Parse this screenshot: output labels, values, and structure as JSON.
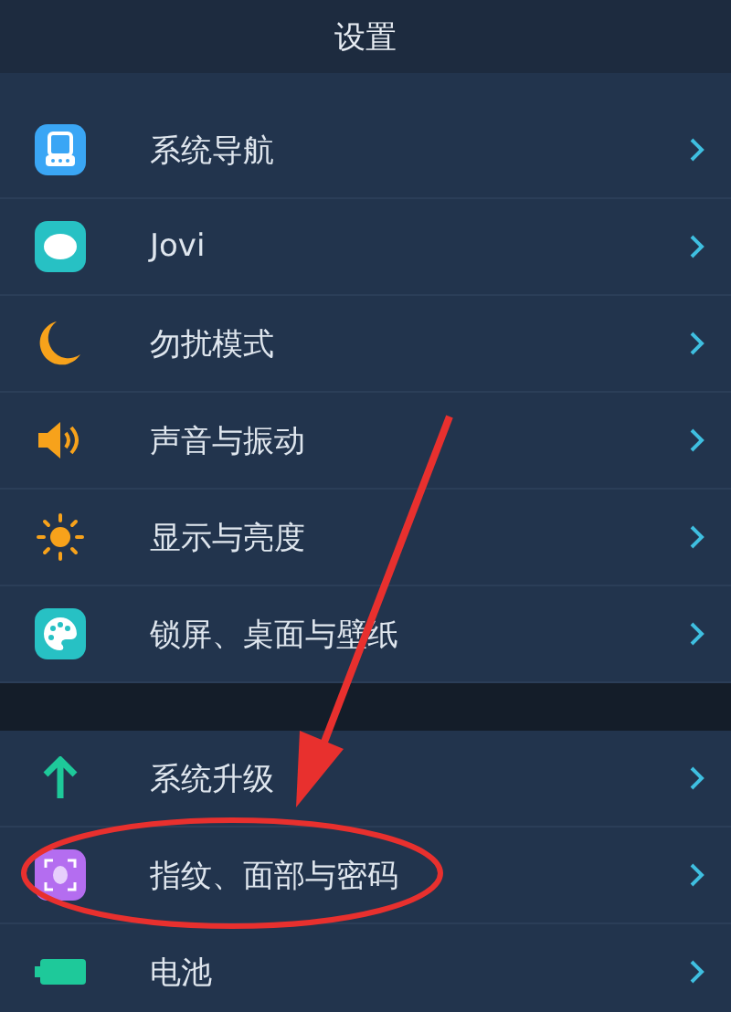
{
  "header": {
    "title": "设置"
  },
  "sections": [
    {
      "items": [
        {
          "label": "系统导航",
          "kind": "nav"
        },
        {
          "label": "Jovi",
          "kind": "jovi"
        },
        {
          "label": "勿扰模式",
          "kind": "moon"
        },
        {
          "label": "声音与振动",
          "kind": "speaker"
        },
        {
          "label": "显示与亮度",
          "kind": "sun"
        },
        {
          "label": "锁屏、桌面与壁纸",
          "kind": "palette"
        }
      ]
    },
    {
      "items": [
        {
          "label": "系统升级",
          "kind": "up"
        },
        {
          "label": "指纹、面部与密码",
          "kind": "face"
        },
        {
          "label": "电池",
          "kind": "battery"
        }
      ]
    }
  ]
}
